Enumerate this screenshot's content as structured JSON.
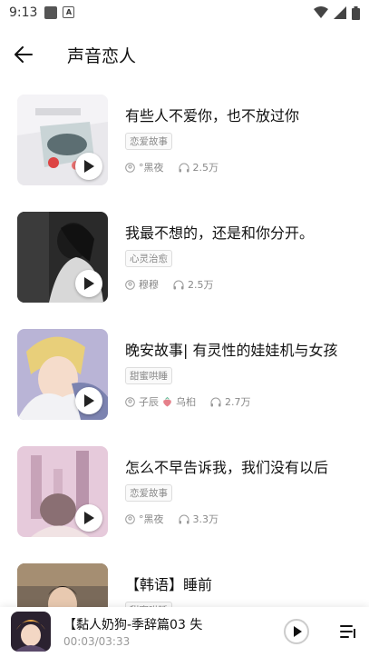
{
  "status": {
    "time": "9:13"
  },
  "header": {
    "title": "声音恋人",
    "back_icon": "arrow-left-icon"
  },
  "items": [
    {
      "title": "有些人不爱你，也不放过你",
      "tag": "恋爱故事",
      "author": "°黑夜",
      "author2": "",
      "plays": "2.5万"
    },
    {
      "title": "我最不想的，还是和你分开。",
      "tag": "心灵治愈",
      "author": "穆穆",
      "author2": "",
      "plays": "2.5万"
    },
    {
      "title": "晚安故事| 有灵性的娃娃机与女孩",
      "tag": "甜蜜哄睡",
      "author": "子辰",
      "author2": "乌桕",
      "plays": "2.7万"
    },
    {
      "title": "怎么不早告诉我，我们没有以后",
      "tag": "恋爱故事",
      "author": "°黑夜",
      "author2": "",
      "plays": "3.3万"
    },
    {
      "title": "【韩语】睡前",
      "tag": "甜蜜哄睡",
      "author": "",
      "author2": "",
      "plays": ""
    }
  ],
  "player": {
    "title": "【黏人奶狗-季辞篇03 失",
    "time": "00:03/03:33"
  },
  "colors": {
    "accent": "#111111",
    "muted": "#888888"
  }
}
